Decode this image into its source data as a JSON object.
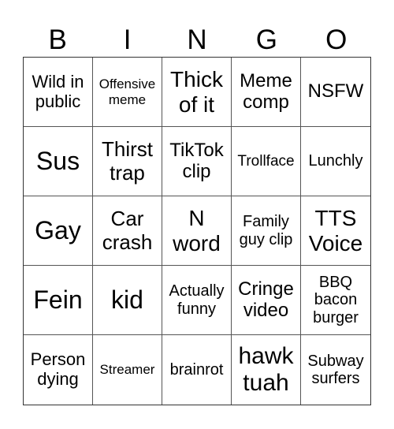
{
  "header": [
    "B",
    "I",
    "N",
    "G",
    "O"
  ],
  "cells": [
    "Wild in public",
    "Offensive meme",
    "Thick of it",
    "Meme comp",
    "NSFW",
    "Sus",
    "Thirst trap",
    "TikTok clip",
    "Trollface",
    "Lunchly",
    "Gay",
    "Car crash",
    "N word",
    "Family guy clip",
    "TTS Voice",
    "Fein",
    "kid",
    "Actually funny",
    "Cringe video",
    "BBQ bacon burger",
    "Person dying",
    "Streamer",
    "brainrot",
    "hawk tuah",
    "Subway surfers"
  ]
}
